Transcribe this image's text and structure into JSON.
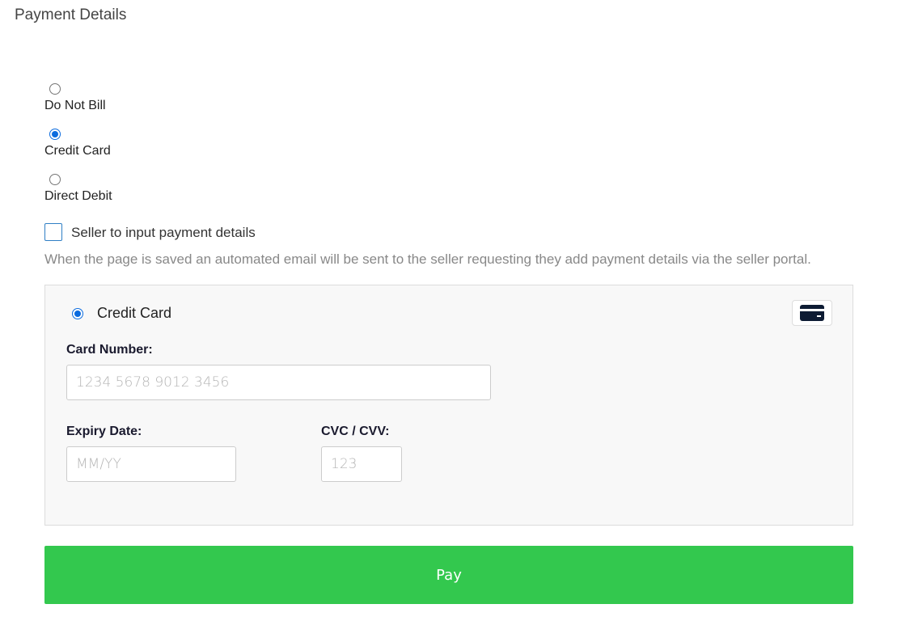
{
  "page": {
    "title": "Payment Details"
  },
  "billing_options": [
    {
      "label": "Do Not Bill",
      "selected": false
    },
    {
      "label": "Credit Card",
      "selected": true
    },
    {
      "label": "Direct Debit",
      "selected": false
    }
  ],
  "seller_checkbox": {
    "label": "Seller to input payment details",
    "checked": false,
    "help_text": "When the page is saved an automated email will be sent to the seller requesting they add payment details via the seller portal."
  },
  "card_panel": {
    "method_label": "Credit Card",
    "method_selected": true,
    "icon": "credit-card-icon",
    "card_number": {
      "label": "Card Number:",
      "value": "",
      "placeholder": "1234 5678 9012 3456"
    },
    "expiry": {
      "label": "Expiry Date:",
      "value": "",
      "placeholder": "MM/YY"
    },
    "cvc": {
      "label": "CVC / CVV:",
      "value": "",
      "placeholder": "123"
    }
  },
  "actions": {
    "pay_label": "Pay"
  },
  "colors": {
    "accent_blue": "#0b6bde",
    "pay_green": "#33c84e",
    "panel_bg": "#f8f8f8",
    "help_text": "#888888"
  }
}
